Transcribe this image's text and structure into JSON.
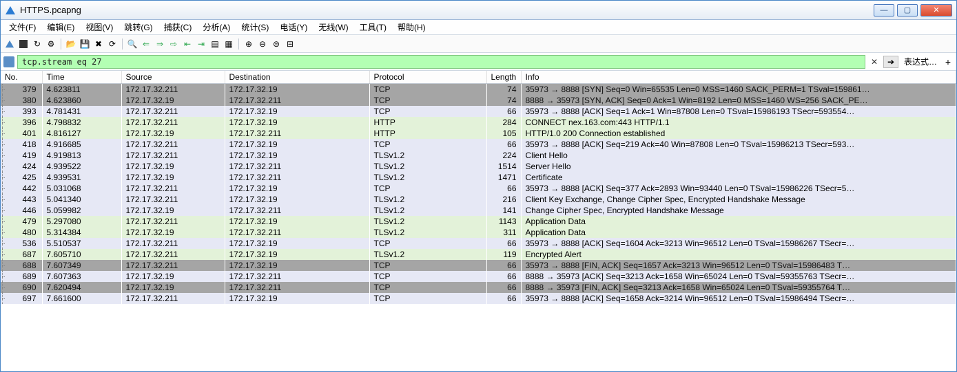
{
  "window": {
    "title": "HTTPS.pcapng"
  },
  "menubar": [
    {
      "label": "文件(F)"
    },
    {
      "label": "编辑(E)"
    },
    {
      "label": "视图(V)"
    },
    {
      "label": "跳转(G)"
    },
    {
      "label": "捕获(C)"
    },
    {
      "label": "分析(A)"
    },
    {
      "label": "统计(S)"
    },
    {
      "label": "电话(Y)"
    },
    {
      "label": "无线(W)"
    },
    {
      "label": "工具(T)"
    },
    {
      "label": "帮助(H)"
    }
  ],
  "filter": {
    "value": "tcp.stream eq 27",
    "expression_label": "表达式…",
    "clear_glyph": "✕",
    "go_glyph": "➔",
    "plus_glyph": "+"
  },
  "columns": {
    "no": "No.",
    "time": "Time",
    "source": "Source",
    "destination": "Destination",
    "protocol": "Protocol",
    "length": "Length",
    "info": "Info"
  },
  "rows": [
    {
      "no": "379",
      "time": "4.623811",
      "src": "172.17.32.211",
      "dst": "172.17.32.19",
      "proto": "TCP",
      "len": "74",
      "info": "35973 → 8888 [SYN] Seq=0 Win=65535 Len=0 MSS=1460 SACK_PERM=1 TSval=159861…",
      "cls": "dark-gray"
    },
    {
      "no": "380",
      "time": "4.623860",
      "src": "172.17.32.19",
      "dst": "172.17.32.211",
      "proto": "TCP",
      "len": "74",
      "info": "8888 → 35973 [SYN, ACK] Seq=0 Ack=1 Win=8192 Len=0 MSS=1460 WS=256 SACK_PE…",
      "cls": "dark-gray"
    },
    {
      "no": "393",
      "time": "4.781431",
      "src": "172.17.32.211",
      "dst": "172.17.32.19",
      "proto": "TCP",
      "len": "66",
      "info": "35973 → 8888 [ACK] Seq=1 Ack=1 Win=87808 Len=0 TSval=15986193 TSecr=593554…",
      "cls": "pale-blue"
    },
    {
      "no": "396",
      "time": "4.798832",
      "src": "172.17.32.211",
      "dst": "172.17.32.19",
      "proto": "HTTP",
      "len": "284",
      "info": "CONNECT nex.163.com:443 HTTP/1.1",
      "cls": "pale-green"
    },
    {
      "no": "401",
      "time": "4.816127",
      "src": "172.17.32.19",
      "dst": "172.17.32.211",
      "proto": "HTTP",
      "len": "105",
      "info": "HTTP/1.0 200 Connection established",
      "cls": "pale-green"
    },
    {
      "no": "418",
      "time": "4.916685",
      "src": "172.17.32.211",
      "dst": "172.17.32.19",
      "proto": "TCP",
      "len": "66",
      "info": "35973 → 8888 [ACK] Seq=219 Ack=40 Win=87808 Len=0 TSval=15986213 TSecr=593…",
      "cls": "pale-blue"
    },
    {
      "no": "419",
      "time": "4.919813",
      "src": "172.17.32.211",
      "dst": "172.17.32.19",
      "proto": "TLSv1.2",
      "len": "224",
      "info": "Client Hello",
      "cls": "pale-blue"
    },
    {
      "no": "424",
      "time": "4.939522",
      "src": "172.17.32.19",
      "dst": "172.17.32.211",
      "proto": "TLSv1.2",
      "len": "1514",
      "info": "Server Hello",
      "cls": "pale-blue"
    },
    {
      "no": "425",
      "time": "4.939531",
      "src": "172.17.32.19",
      "dst": "172.17.32.211",
      "proto": "TLSv1.2",
      "len": "1471",
      "info": "Certificate",
      "cls": "pale-blue"
    },
    {
      "no": "442",
      "time": "5.031068",
      "src": "172.17.32.211",
      "dst": "172.17.32.19",
      "proto": "TCP",
      "len": "66",
      "info": "35973 → 8888 [ACK] Seq=377 Ack=2893 Win=93440 Len=0 TSval=15986226 TSecr=5…",
      "cls": "pale-blue"
    },
    {
      "no": "443",
      "time": "5.041340",
      "src": "172.17.32.211",
      "dst": "172.17.32.19",
      "proto": "TLSv1.2",
      "len": "216",
      "info": "Client Key Exchange, Change Cipher Spec, Encrypted Handshake Message",
      "cls": "pale-blue"
    },
    {
      "no": "446",
      "time": "5.059982",
      "src": "172.17.32.19",
      "dst": "172.17.32.211",
      "proto": "TLSv1.2",
      "len": "141",
      "info": "Change Cipher Spec, Encrypted Handshake Message",
      "cls": "pale-blue"
    },
    {
      "no": "479",
      "time": "5.297080",
      "src": "172.17.32.211",
      "dst": "172.17.32.19",
      "proto": "TLSv1.2",
      "len": "1143",
      "info": "Application Data",
      "cls": "pale-green"
    },
    {
      "no": "480",
      "time": "5.314384",
      "src": "172.17.32.19",
      "dst": "172.17.32.211",
      "proto": "TLSv1.2",
      "len": "311",
      "info": "Application Data",
      "cls": "pale-green"
    },
    {
      "no": "536",
      "time": "5.510537",
      "src": "172.17.32.211",
      "dst": "172.17.32.19",
      "proto": "TCP",
      "len": "66",
      "info": "35973 → 8888 [ACK] Seq=1604 Ack=3213 Win=96512 Len=0 TSval=15986267 TSecr=…",
      "cls": "pale-blue"
    },
    {
      "no": "687",
      "time": "7.605710",
      "src": "172.17.32.211",
      "dst": "172.17.32.19",
      "proto": "TLSv1.2",
      "len": "119",
      "info": "Encrypted Alert",
      "cls": "pale-green"
    },
    {
      "no": "688",
      "time": "7.607349",
      "src": "172.17.32.211",
      "dst": "172.17.32.19",
      "proto": "TCP",
      "len": "66",
      "info": "35973 → 8888 [FIN, ACK] Seq=1657 Ack=3213 Win=96512 Len=0 TSval=15986483 T…",
      "cls": "dark-gray"
    },
    {
      "no": "689",
      "time": "7.607363",
      "src": "172.17.32.19",
      "dst": "172.17.32.211",
      "proto": "TCP",
      "len": "66",
      "info": "8888 → 35973 [ACK] Seq=3213 Ack=1658 Win=65024 Len=0 TSval=59355763 TSecr=…",
      "cls": "pale-blue"
    },
    {
      "no": "690",
      "time": "7.620494",
      "src": "172.17.32.19",
      "dst": "172.17.32.211",
      "proto": "TCP",
      "len": "66",
      "info": "8888 → 35973 [FIN, ACK] Seq=3213 Ack=1658 Win=65024 Len=0 TSval=59355764 T…",
      "cls": "dark-gray"
    },
    {
      "no": "697",
      "time": "7.661600",
      "src": "172.17.32.211",
      "dst": "172.17.32.19",
      "proto": "TCP",
      "len": "66",
      "info": "35973 → 8888 [ACK] Seq=1658 Ack=3214 Win=96512 Len=0 TSval=15986494 TSecr=…",
      "cls": "pale-blue"
    }
  ]
}
